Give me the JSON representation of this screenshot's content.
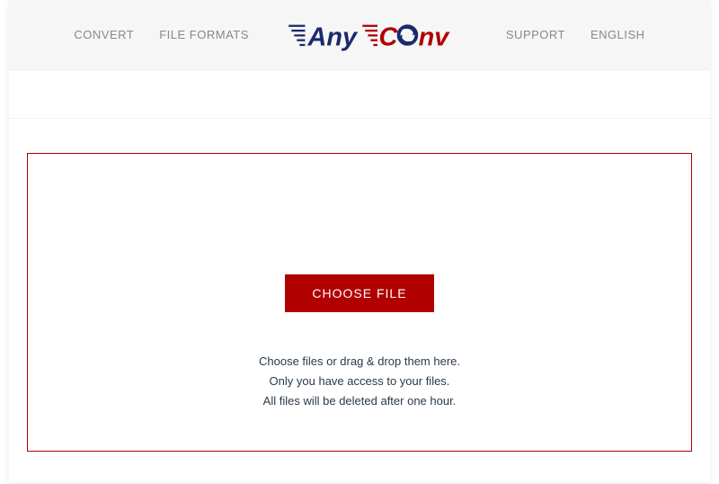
{
  "header": {
    "nav_left": [
      {
        "label": "CONVERT"
      },
      {
        "label": "FILE FORMATS"
      }
    ],
    "nav_right": [
      {
        "label": "SUPPORT"
      },
      {
        "label": "ENGLISH"
      }
    ],
    "logo": {
      "text_any": "Any",
      "text_c": "C",
      "text_nv": "nv",
      "color_blue": "#1a2a6c",
      "color_red": "#b00000"
    }
  },
  "dropzone": {
    "button_label": "CHOOSE FILE",
    "info_lines": [
      "Choose files or drag & drop them here.",
      "Only you have access to your files.",
      "All files will be deleted after one hour."
    ],
    "border_color": "#b00000",
    "button_bg": "#b00000"
  }
}
